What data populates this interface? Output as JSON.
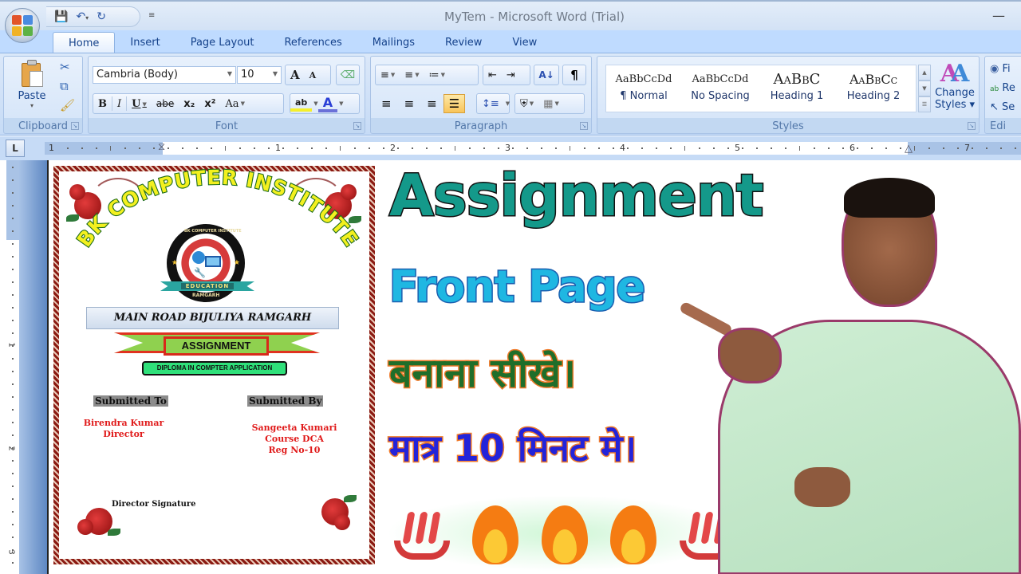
{
  "window": {
    "title": "MyTem - Microsoft Word (Trial)",
    "minimize_icon": "minimize-icon"
  },
  "quick_access": {
    "save_icon": "save-icon",
    "undo_icon": "undo-icon",
    "redo_icon": "redo-icon",
    "customize_icon": "customize-qat-icon"
  },
  "tabs": [
    {
      "label": "Home",
      "active": true
    },
    {
      "label": "Insert"
    },
    {
      "label": "Page Layout"
    },
    {
      "label": "References"
    },
    {
      "label": "Mailings"
    },
    {
      "label": "Review"
    },
    {
      "label": "View"
    }
  ],
  "ribbon": {
    "clipboard": {
      "label": "Clipboard",
      "paste_label": "Paste"
    },
    "font": {
      "label": "Font",
      "font_name": "Cambria (Body)",
      "font_size": "10",
      "grow": "A",
      "shrink": "A",
      "bold": "B",
      "italic": "I",
      "underline": "U",
      "strikethrough": "abe",
      "subscript": "x₂",
      "superscript": "x²",
      "change_case": "Aa",
      "highlight": "ab",
      "font_color": "A"
    },
    "paragraph": {
      "label": "Paragraph",
      "show_marks": "¶",
      "sort": "A↓"
    },
    "styles": {
      "label": "Styles",
      "items": [
        {
          "preview": "AaBbCcDd",
          "name": "¶ Normal"
        },
        {
          "preview": "AaBbCcDd",
          "name": "No Spacing"
        },
        {
          "preview": "AaBbC",
          "name": "Heading 1"
        },
        {
          "preview": "AaBbCc",
          "name": "Heading 2"
        }
      ],
      "change_styles_line1": "Change",
      "change_styles_line2": "Styles ▾"
    },
    "editing": {
      "label": "Edi",
      "find": "Fi",
      "replace": "Re",
      "select": "Se"
    }
  },
  "ruler": {
    "tab_selector": "L",
    "h_numbers": [
      "1",
      "1",
      "2",
      "3",
      "4",
      "5",
      "6",
      "7"
    ],
    "v_numbers": [
      "1",
      "2",
      "3"
    ]
  },
  "document": {
    "institute_name": "BK COMPUTER INSTITUTE",
    "logo_ring_top": "BK COMPUTER INSTITUTE",
    "logo_ring_bottom": "RAMGARH",
    "logo_banner": "EDUCATION",
    "address": "MAIN ROAD BIJULIYA RAMGARH",
    "assignment_label": "ASSIGNMENT",
    "course_label": "DIPLOMA IN COMPTER APPLICATION",
    "submitted_to_heading": "Submitted To",
    "submitted_to_lines": [
      "Birendra Kumar",
      "Director"
    ],
    "submitted_by_heading": "Submitted By",
    "submitted_by_lines": [
      "Sangeeta Kumari",
      "Course DCA",
      "Reg No-10"
    ],
    "signature_label": "Director Signature"
  },
  "thumbnail": {
    "title": "Assignment",
    "subtitle": "Front Page",
    "hindi_line1": "बनाना सीखे।",
    "hindi_line2": "मात्र 10 मिनट मे।",
    "emojis": [
      "hot-springs",
      "fire",
      "fire",
      "fire",
      "hot-springs"
    ],
    "colors": {
      "title": "#14998a",
      "subtitle": "#1fb7e2",
      "hindi_line1": "#1f6e2a",
      "hindi_line2": "#2323d9",
      "outline_orange": "#f07a2a"
    }
  }
}
